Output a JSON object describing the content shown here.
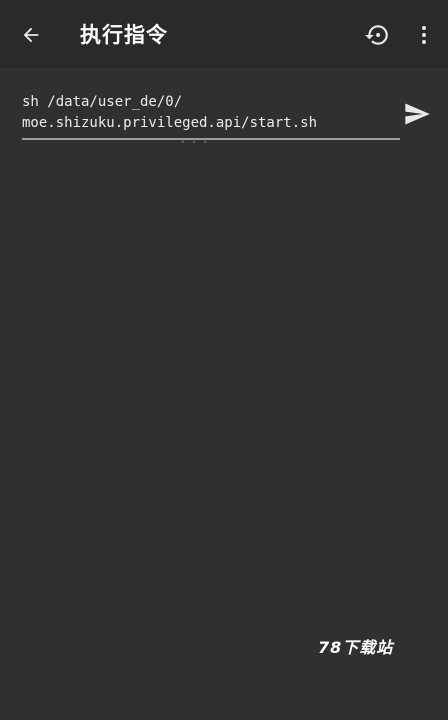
{
  "app_bar": {
    "title": "执行指令",
    "back_icon": "arrow-back-icon",
    "history_icon": "history-icon",
    "more_icon": "more-vert-icon"
  },
  "command": {
    "line1": "sh /data/user_de/0/",
    "line2": "moe.shizuku.privileged.api/start.sh"
  },
  "send_icon": "send-icon",
  "watermark": "78下载站",
  "colors": {
    "background": "#303030",
    "app_bar": "#2a2a2a",
    "text": "#ffffff",
    "underline": "#9e9e9e"
  }
}
